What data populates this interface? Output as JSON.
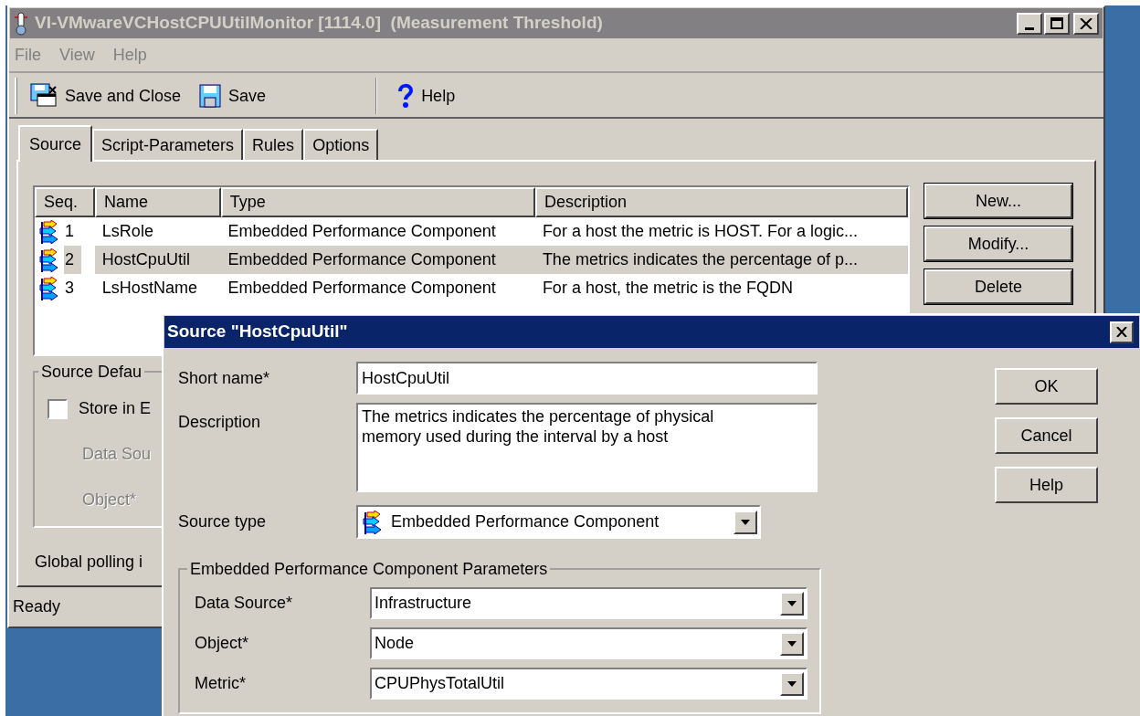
{
  "main_window": {
    "title": "VI-VMwareVCHostCPUUtilMonitor [1114.0]  (Measurement Threshold)",
    "active": false,
    "menu": [
      {
        "label": "File",
        "disabled": true
      },
      {
        "label": "View",
        "disabled": true
      },
      {
        "label": "Help",
        "disabled": true
      }
    ],
    "toolbar_groups": [
      {
        "items": [
          {
            "kind": "save-close",
            "label": "Save and Close"
          },
          {
            "kind": "save",
            "label": "Save"
          }
        ]
      },
      {
        "items": [
          {
            "kind": "help",
            "label": "Help"
          }
        ]
      }
    ],
    "tabs": [
      {
        "label": "Source",
        "selected": true
      },
      {
        "label": "Script-Parameters",
        "selected": false
      },
      {
        "label": "Rules",
        "selected": false
      },
      {
        "label": "Options",
        "selected": false
      }
    ],
    "list": {
      "columns": [
        "Seq.",
        "Name",
        "Type",
        "Description"
      ],
      "rows": [
        {
          "seq": "1",
          "name": "LsRole",
          "type": "Embedded Performance Component",
          "description": "For a host the metric is HOST. For a logic...",
          "selected": false
        },
        {
          "seq": "2",
          "name": "HostCpuUtil",
          "type": "Embedded Performance Component",
          "description": "The metrics indicates the percentage of p...",
          "selected": true
        },
        {
          "seq": "3",
          "name": "LsHostName",
          "type": "Embedded Performance Component",
          "description": "For a host, the metric is the FQDN",
          "selected": false
        }
      ]
    },
    "buttons": [
      "New...",
      "Modify...",
      "Delete"
    ],
    "source_defaults": {
      "title": "Source Defau",
      "checkbox": {
        "label": "Store in E",
        "checked": false
      },
      "fields": [
        {
          "label": "Data Sou",
          "disabled": true
        },
        {
          "label": "Object*",
          "disabled": true
        }
      ]
    },
    "global_polling": "Global polling i",
    "status_bar": "Ready"
  },
  "dialog": {
    "title": "Source \"HostCpuUtil\"",
    "active": true,
    "fields": [
      {
        "kind": "text",
        "label": "Short name*",
        "value": "HostCpuUtil"
      },
      {
        "kind": "textarea",
        "label": "Description",
        "value": "The metrics indicates the percentage of physical memory used during the interval by a host"
      },
      {
        "kind": "icon-combo",
        "label": "Source type",
        "value": "Embedded Performance Component"
      }
    ],
    "buttons": [
      "OK",
      "Cancel",
      "Help"
    ],
    "parameters": {
      "title": "Embedded Performance Component Parameters",
      "fields": [
        {
          "label": "Data Source*",
          "value": "Infrastructure"
        },
        {
          "label": "Object*",
          "value": "Node"
        },
        {
          "label": "Metric*",
          "value": "CPUPhysTotalUtil"
        }
      ]
    }
  }
}
